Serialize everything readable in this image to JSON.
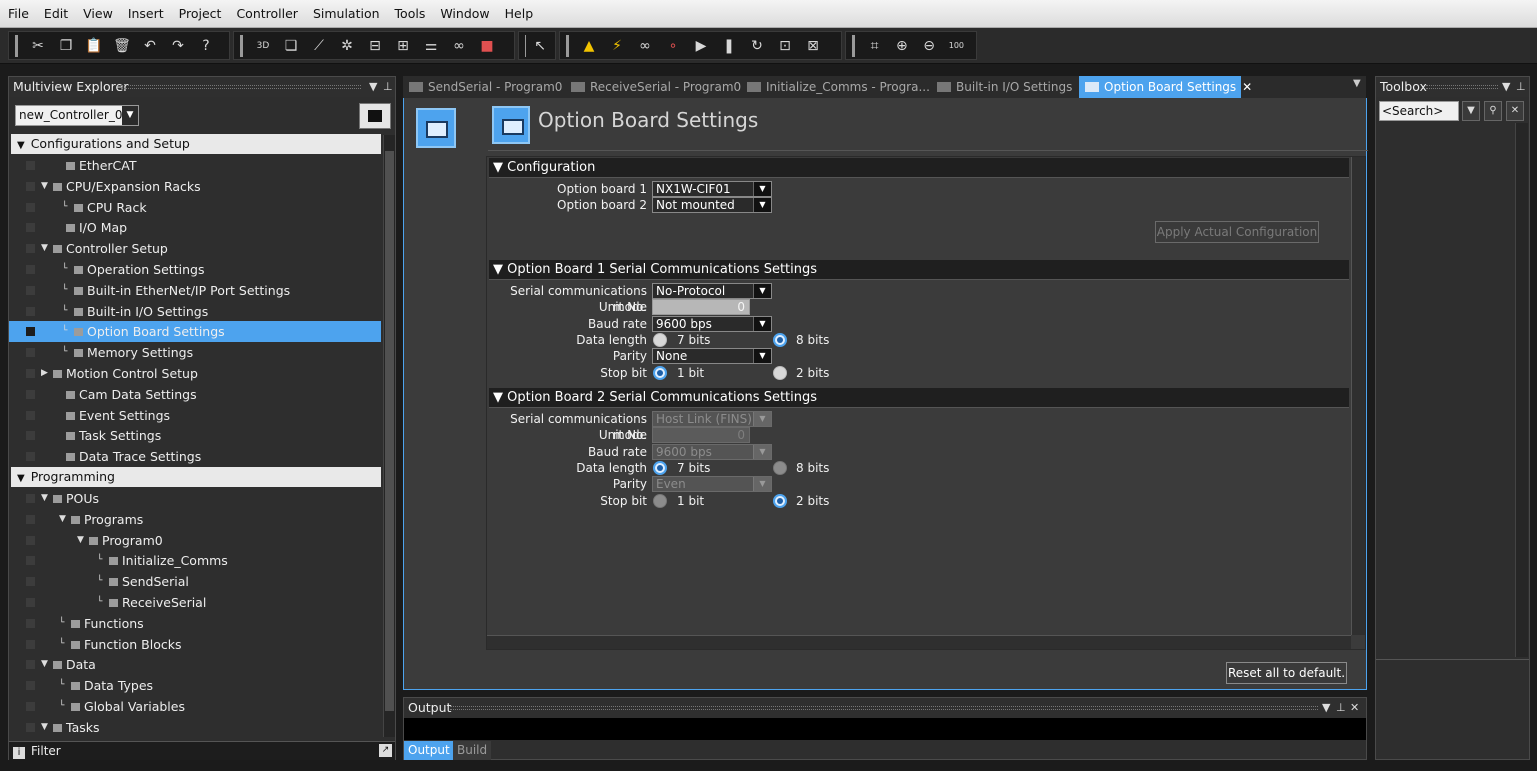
{
  "menu": [
    "File",
    "Edit",
    "View",
    "Insert",
    "Project",
    "Controller",
    "Simulation",
    "Tools",
    "Window",
    "Help"
  ],
  "toolbar": {
    "group1": [
      "cut-icon",
      "copy-icon",
      "paste-icon",
      "delete-icon",
      "undo-icon",
      "redo-icon",
      "help-icon"
    ],
    "group2": [
      "3d-icon",
      "window-icon",
      "build-icon",
      "wrench-icon",
      "compare-icon",
      "transfer-icon",
      "network-icon",
      "binoculars-icon",
      "stop-icon"
    ],
    "group3": [
      "online-icon"
    ],
    "group4": [
      "warning-icon",
      "sync-icon",
      "link-icon",
      "monitor-icon",
      "run-icon",
      "pause-icon",
      "cycle-icon",
      "watch-icon",
      "cross-ref-icon"
    ],
    "group5": [
      "fit-icon",
      "zoom-in-icon",
      "zoom-out-icon",
      "zoom-100-icon"
    ],
    "zoom_label": "100"
  },
  "explorer": {
    "title": "Multiview Explorer",
    "controller": "new_Controller_0",
    "filter_label": "Filter",
    "sections": {
      "config": "Configurations and Setup",
      "programming": "Programming"
    },
    "config_items": [
      {
        "label": "EtherCAT",
        "prefix": ""
      },
      {
        "label": "CPU/Expansion Racks",
        "prefix": "▼"
      },
      {
        "label": "CPU Rack",
        "prefix": "└"
      },
      {
        "label": "I/O Map",
        "prefix": ""
      },
      {
        "label": "Controller Setup",
        "prefix": "▼"
      },
      {
        "label": "Operation Settings",
        "prefix": "└"
      },
      {
        "label": "Built-in EtherNet/IP Port Settings",
        "prefix": "└"
      },
      {
        "label": "Built-in I/O Settings",
        "prefix": "└"
      },
      {
        "label": "Option Board Settings",
        "prefix": "└"
      },
      {
        "label": "Memory Settings",
        "prefix": "└"
      },
      {
        "label": "Motion Control Setup",
        "prefix": "▶"
      },
      {
        "label": "Cam Data Settings",
        "prefix": ""
      },
      {
        "label": "Event Settings",
        "prefix": ""
      },
      {
        "label": "Task Settings",
        "prefix": ""
      },
      {
        "label": "Data Trace Settings",
        "prefix": ""
      }
    ],
    "programming_items": [
      {
        "label": "POUs",
        "prefix": "▼"
      },
      {
        "label": "Programs",
        "prefix": "▼"
      },
      {
        "label": "Program0",
        "prefix": "▼"
      },
      {
        "label": "Initialize_Comms",
        "prefix": "└"
      },
      {
        "label": "SendSerial",
        "prefix": "└"
      },
      {
        "label": "ReceiveSerial",
        "prefix": "└"
      },
      {
        "label": "Functions",
        "prefix": "└"
      },
      {
        "label": "Function Blocks",
        "prefix": "└"
      },
      {
        "label": "Data",
        "prefix": "▼"
      },
      {
        "label": "Data Types",
        "prefix": "└"
      },
      {
        "label": "Global Variables",
        "prefix": "└"
      },
      {
        "label": "Tasks",
        "prefix": "▼"
      }
    ]
  },
  "tabs": [
    {
      "label": "SendSerial - Program0",
      "active": false
    },
    {
      "label": "ReceiveSerial - Program0",
      "active": false
    },
    {
      "label": "Initialize_Comms - Progra...",
      "active": false
    },
    {
      "label": "Built-in I/O Settings",
      "active": false
    },
    {
      "label": "Option Board Settings",
      "active": true
    }
  ],
  "editor": {
    "title": "Option Board Settings",
    "configuration": {
      "heading": "Configuration",
      "option_board_1_label": "Option board 1",
      "option_board_1_value": "NX1W-CIF01",
      "option_board_2_label": "Option board 2",
      "option_board_2_value": "Not mounted",
      "apply_button": "Apply Actual Configuration"
    },
    "board1": {
      "heading": "Option Board 1 Serial Communications Settings",
      "mode_label": "Serial communications mode",
      "mode_value": "No-Protocol",
      "unit_label": "Unit No.",
      "unit_value": "0",
      "baud_label": "Baud rate",
      "baud_value": "9600 bps",
      "datalen_label": "Data length",
      "datalen_opt1": "7 bits",
      "datalen_opt2": "8 bits",
      "parity_label": "Parity",
      "parity_value": "None",
      "stop_label": "Stop bit",
      "stop_opt1": "1 bit",
      "stop_opt2": "2 bits"
    },
    "board2": {
      "heading": "Option Board 2 Serial Communications Settings",
      "mode_label": "Serial communications mode",
      "mode_value": "Host Link (FINS)",
      "unit_label": "Unit No.",
      "unit_value": "0",
      "baud_label": "Baud rate",
      "baud_value": "9600 bps",
      "datalen_label": "Data length",
      "datalen_opt1": "7 bits",
      "datalen_opt2": "8 bits",
      "parity_label": "Parity",
      "parity_value": "Even",
      "stop_label": "Stop bit",
      "stop_opt1": "1 bit",
      "stop_opt2": "2 bits"
    },
    "reset_button": "Reset all to default."
  },
  "toolbox": {
    "title": "Toolbox",
    "search_placeholder": "<Search>"
  },
  "output": {
    "title": "Output",
    "tab_output": "Output",
    "tab_build": "Build"
  },
  "colors": {
    "accent": "#4da3ee",
    "background": "#1b1b1b",
    "panel": "#2e2e2e",
    "editor": "#3b3b3b"
  }
}
